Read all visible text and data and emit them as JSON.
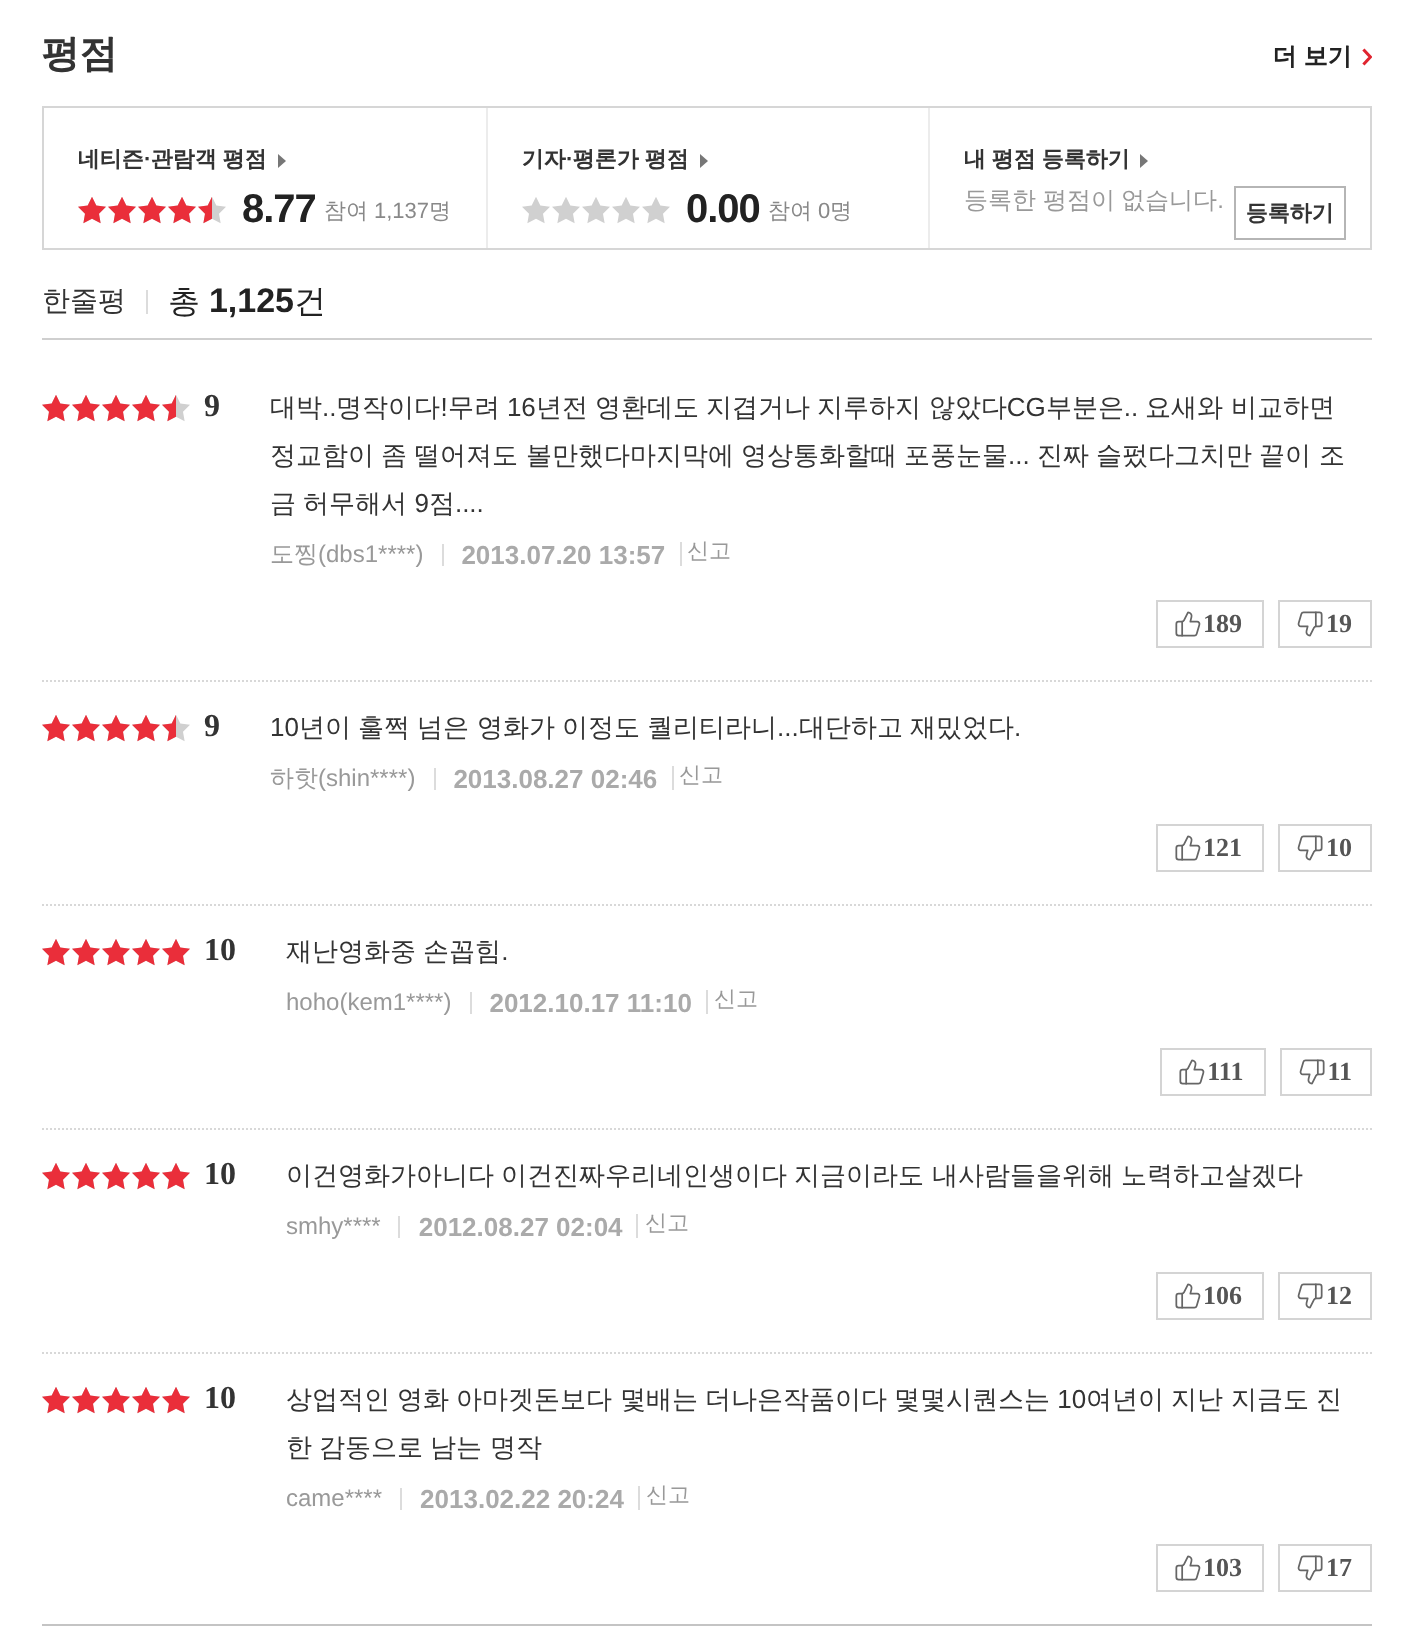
{
  "header": {
    "title": "평점",
    "more_link": "더 보기"
  },
  "summary": [
    {
      "kind": "rating",
      "label": "네티즌·관람객 평점",
      "stars": 4.5,
      "score": "8.77",
      "participants": "참여 1,137명"
    },
    {
      "kind": "rating",
      "label": "기자·평론가 평점",
      "stars": 0,
      "score": "0.00",
      "participants": "참여 0명"
    },
    {
      "kind": "register",
      "label": "내 평점 등록하기",
      "message": "등록한 평점이 없습니다.",
      "button": "등록하기"
    }
  ],
  "reviews_header": {
    "title": "한줄평",
    "total": "총 **1,125**건"
  },
  "reviews": [
    {
      "stars": 4.5,
      "score": "9",
      "text": "대박..명작이다!무려 16년전 영환데도 지겹거나 지루하지 않았다CG부분은.. 요새와 비교하면 정교함이 좀 떨어져도 볼만했다마지막에 영상통화할때 포풍눈물... 진짜 슬펐다그치만 끝이 조금 허무해서 9점....",
      "author": "도찡(dbs1****)",
      "date": "2013.07.20 13:57",
      "report": "신고",
      "likes": "189",
      "dislikes": "19"
    },
    {
      "stars": 4.5,
      "score": "9",
      "text": "10년이 훌쩍 넘은 영화가 이정도 퀄리티라니...대단하고 재밌었다.",
      "author": "하핫(shin****)",
      "date": "2013.08.27 02:46",
      "report": "신고",
      "likes": "121",
      "dislikes": "10"
    },
    {
      "stars": 5,
      "score": "10",
      "text": "재난영화중 손꼽힘.",
      "author": "hoho(kem1****)",
      "date": "2012.10.17 11:10",
      "report": "신고",
      "likes": "111",
      "dislikes": "11"
    },
    {
      "stars": 5,
      "score": "10",
      "text": "이건영화가아니다 이건진짜우리네인생이다 지금이라도 내사람들을위해 노력하고살겠다",
      "author": "smhy****",
      "date": "2012.08.27 02:04",
      "report": "신고",
      "likes": "106",
      "dislikes": "12"
    },
    {
      "stars": 5,
      "score": "10",
      "text": "상업적인 영화 아마겟돈보다 몇배는 더나은작품이다 몇몇시퀀스는 10여년이 지난 지금도 진한 감동으로 남는 명작",
      "author": "came****",
      "date": "2013.02.22 20:24",
      "report": "신고",
      "likes": "103",
      "dislikes": "17"
    }
  ]
}
